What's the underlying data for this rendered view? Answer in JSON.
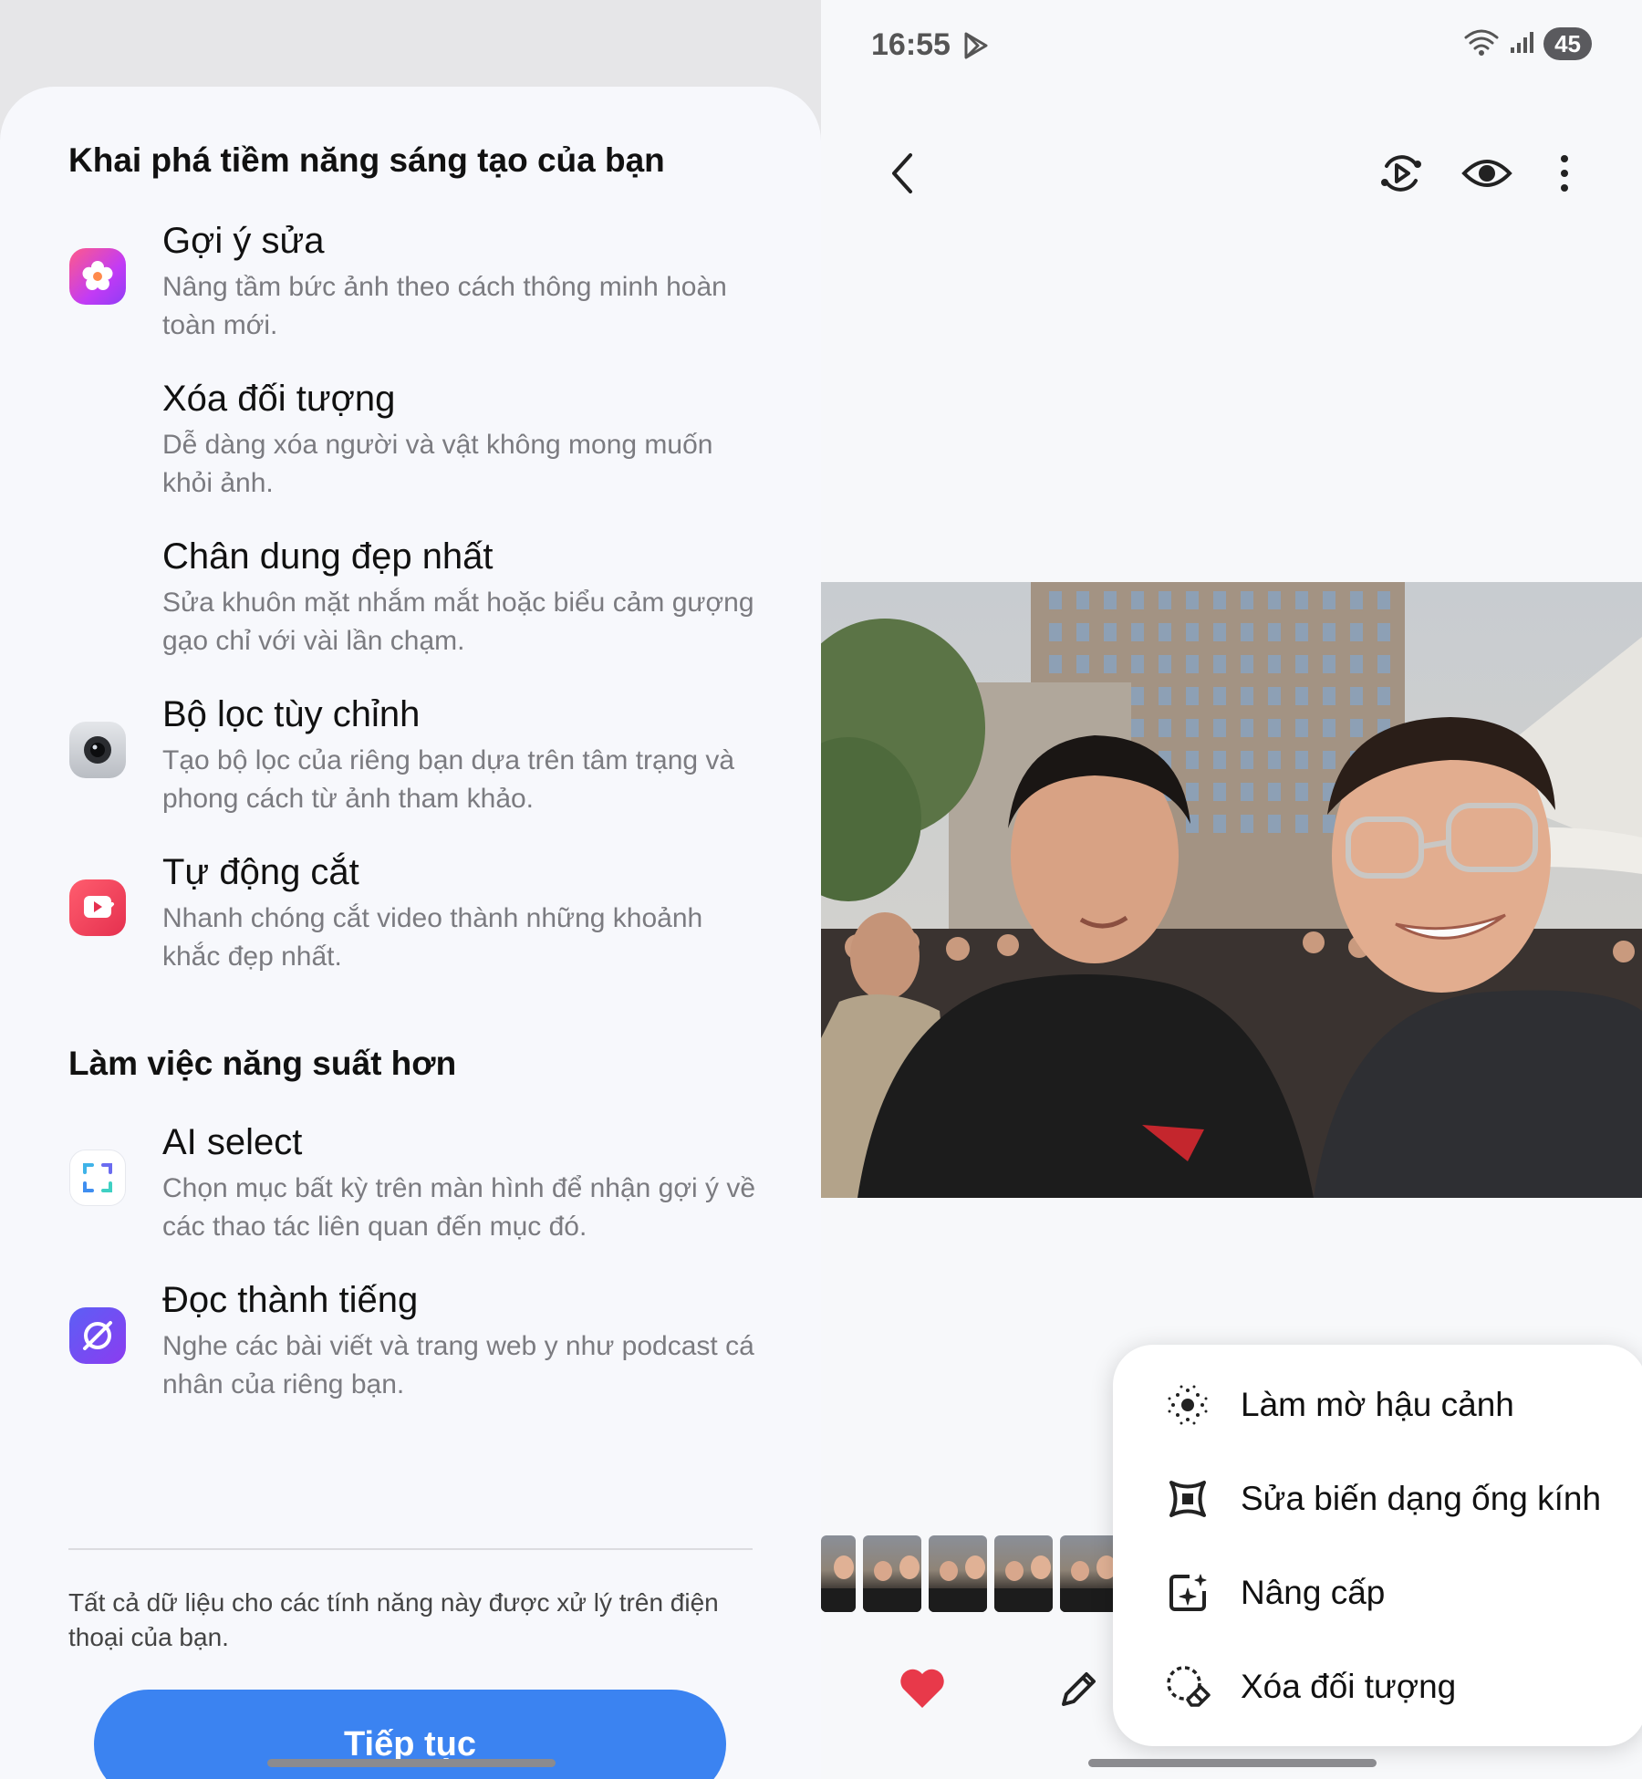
{
  "left": {
    "section1_title": "Khai phá tiềm năng sáng tạo của bạn",
    "section2_title": "Làm việc năng suất hơn",
    "features": [
      {
        "title": "Gợi ý sửa",
        "desc": "Nâng tầm bức ảnh theo cách thông minh hoàn toàn mới.",
        "icon": "gallery-flower-icon"
      },
      {
        "title": "Xóa đối tượng",
        "desc": "Dễ dàng xóa người và vật không mong muốn khỏi ảnh.",
        "icon": ""
      },
      {
        "title": "Chân dung đẹp nhất",
        "desc": "Sửa khuôn mặt nhắm mắt hoặc biểu cảm gượng gạo chỉ với vài lần chạm.",
        "icon": ""
      },
      {
        "title": "Bộ lọc tùy chỉnh",
        "desc": "Tạo bộ lọc của riêng bạn dựa trên tâm trạng và phong cách từ ảnh tham khảo.",
        "icon": "camera-icon"
      },
      {
        "title": "Tự động cắt",
        "desc": "Nhanh chóng cắt video thành những khoảnh khắc đẹp nhất.",
        "icon": "video-editor-icon"
      },
      {
        "title": "AI select",
        "desc": "Chọn mục bất kỳ trên màn hình để nhận gợi ý về các thao tác liên quan đến mục đó.",
        "icon": "ai-select-icon"
      },
      {
        "title": "Đọc thành tiếng",
        "desc": "Nghe các bài viết và trang web y như podcast cá nhân của riêng bạn.",
        "icon": "internet-browser-icon"
      }
    ],
    "footnote": "Tất cả dữ liệu cho các tính năng này được xử lý trên điện thoại của bạn.",
    "continue_label": "Tiếp tục"
  },
  "right": {
    "status": {
      "time": "16:55",
      "battery": "45"
    },
    "menu": [
      {
        "label": "Làm mờ hậu cảnh",
        "icon": "background-blur-icon"
      },
      {
        "label": "Sửa biến dạng ống kính",
        "icon": "lens-distortion-icon"
      },
      {
        "label": "Nâng cấp",
        "icon": "upscale-sparkle-icon"
      },
      {
        "label": "Xóa đối tượng",
        "icon": "object-eraser-icon"
      }
    ],
    "colors": {
      "accent": "#3b83f1",
      "heart": "#e8394a"
    }
  }
}
